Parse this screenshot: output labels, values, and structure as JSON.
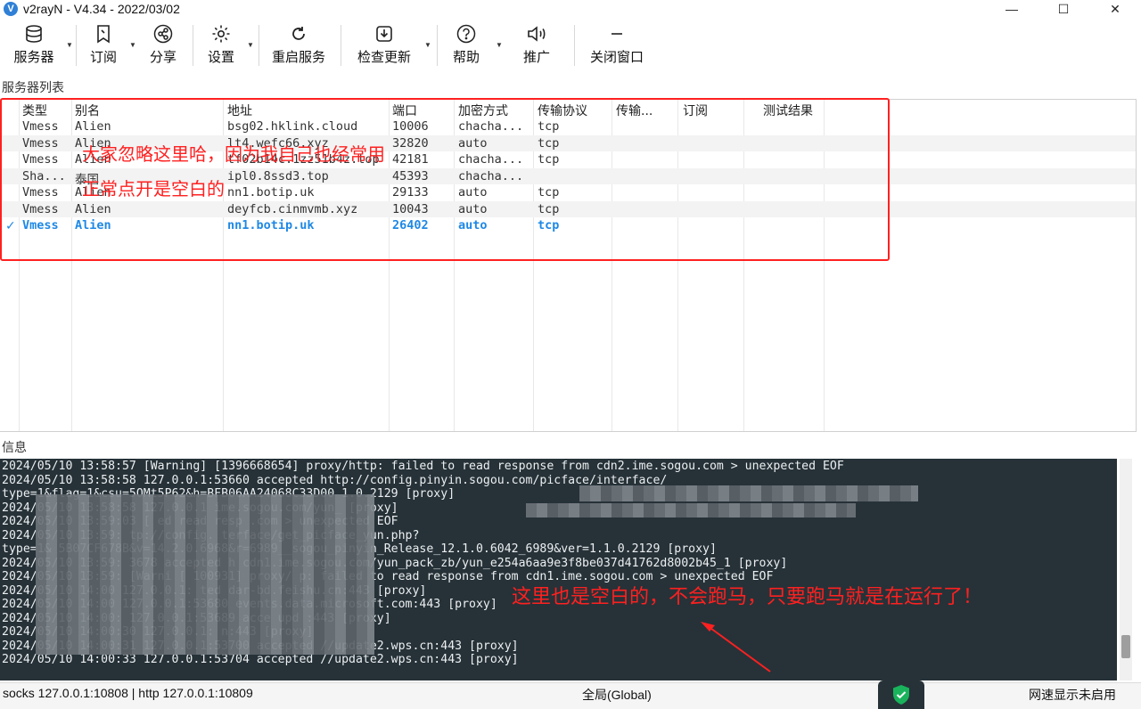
{
  "window": {
    "title": "v2rayN - V4.34 - 2022/03/02",
    "controls": [
      "—",
      "☐",
      "✕"
    ]
  },
  "toolbar": {
    "servers": "服务器",
    "subscribe": "订阅",
    "share": "分享",
    "settings": "设置",
    "restart": "重启服务",
    "check_update": "检查更新",
    "help": "帮助",
    "promote": "推广",
    "close_window": "关闭窗口"
  },
  "server_list": {
    "section_label": "服务器列表",
    "headers": [
      "类型",
      "别名",
      "地址",
      "端口",
      "加密方式",
      "传输协议",
      "传输...",
      "订阅",
      "测试结果"
    ],
    "rows": [
      {
        "type": "Vmess",
        "alias": "Alien",
        "address": "bsg02.hklink.cloud",
        "port": "10006",
        "security": "chacha...",
        "network": "tcp",
        "active": false
      },
      {
        "type": "Vmess",
        "alias": "Alien",
        "address": "lt4.wefc66.xyz",
        "port": "32820",
        "security": "auto",
        "network": "tcp",
        "active": false
      },
      {
        "type": "Vmess",
        "alias": "Alien",
        "address": "tf02b14c.1zz51b4z.top",
        "port": "42181",
        "security": "chacha...",
        "network": "tcp",
        "active": false
      },
      {
        "type": "Sha...",
        "alias": "泰国",
        "address": "ipl0.8ssd3.top",
        "port": "45393",
        "security": "chacha...",
        "network": "",
        "active": false
      },
      {
        "type": "Vmess",
        "alias": "Alien",
        "address": "nn1.botip.uk",
        "port": "29133",
        "security": "auto",
        "network": "tcp",
        "active": false
      },
      {
        "type": "Vmess",
        "alias": "Alien",
        "address": "deyfcb.cinmvmb.xyz",
        "port": "10043",
        "security": "auto",
        "network": "tcp",
        "active": false
      },
      {
        "type": "Vmess",
        "alias": "Alien",
        "address": "nn1.botip.uk",
        "port": "26402",
        "security": "auto",
        "network": "tcp",
        "active": true
      }
    ],
    "active_mark": "✓"
  },
  "annotations": {
    "top_line1": "大家忽略这里哈，因为我自己也经常用",
    "top_line2": "正常点开是空白的",
    "bottom": "这里也是空白的，不会跑马，只要跑马就是在运行了！"
  },
  "log": {
    "section_label": "信息",
    "lines": [
      "2024/05/10 13:58:57 [Warning] [1396668654] proxy/http: failed to read response from cdn2.ime.sogou.com > unexpected EOF",
      "2024/05/10 13:58:58 127.0.0.1:53660 accepted http://config.pinyin.sogou.com/picface/interface/",
      "type=1&flag=1&csu=5OMt5P62&h=BFB06AA24068C33D00                                               1.0.2129 [proxy]",
      "2024/05/10 13:58:58 127.0.0.1            ime.sogou.com/yun_                                     [proxy]",
      "2024/05/10 13:59:03 [                  ed read resp                    .com > unexpected EOF",
      "2024/05/10 13:59:                  tp://config.                 terface/get_picface_yun.php?",
      "type=1&                         5B07CF678B&v=14.2.0.6968&r=6989__sogou_pinyin_Release_12.1.0.6042_6989&ver=1.1.0.2129 [proxy]",
      "2024/05/10 13:59:       3678 accepted h    cdn1.ime.sogou.com/yun_pack_zb/yun_e254a6aa9e3f8be037d41762d8002b45_1 [proxy]",
      "2024/05/10 13:59:  [Warni  [ 100931] proxy/      p: failed to read response from cdn1.ime.sogou.com > unexpected EOF",
      "2024/05/10 14:00   127.0.0.1:         ted      dar-bd.feishu.cn:443 [proxy]",
      "2024/05/10 14:00   127.0.0.1:53680            events.data.microsoft.com:443 [proxy]",
      "2024/05/10 14:00:   127.0.0.1:53689 acce        upd       :443 [proxy]",
      "2024/05/10 14:00:30 127.0.0.1:                     n:443 [proxy]",
      "2024/05/10 14:00:31 127.0.0.1:53700 accepted //update2.wps.cn:443 [proxy]",
      "2024/05/10 14:00:33 127.0.0.1:53704 accepted //update2.wps.cn:443 [proxy]"
    ]
  },
  "status": {
    "ports": "socks 127.0.0.1:10808 | http 127.0.0.1:10809",
    "routing": "全局(Global)",
    "speed": "网速显示未启用"
  },
  "colors": {
    "accent": "#1e88e5",
    "annotation": "#ff2020",
    "log_bg": "#263238",
    "log_text": "#eceff1"
  }
}
